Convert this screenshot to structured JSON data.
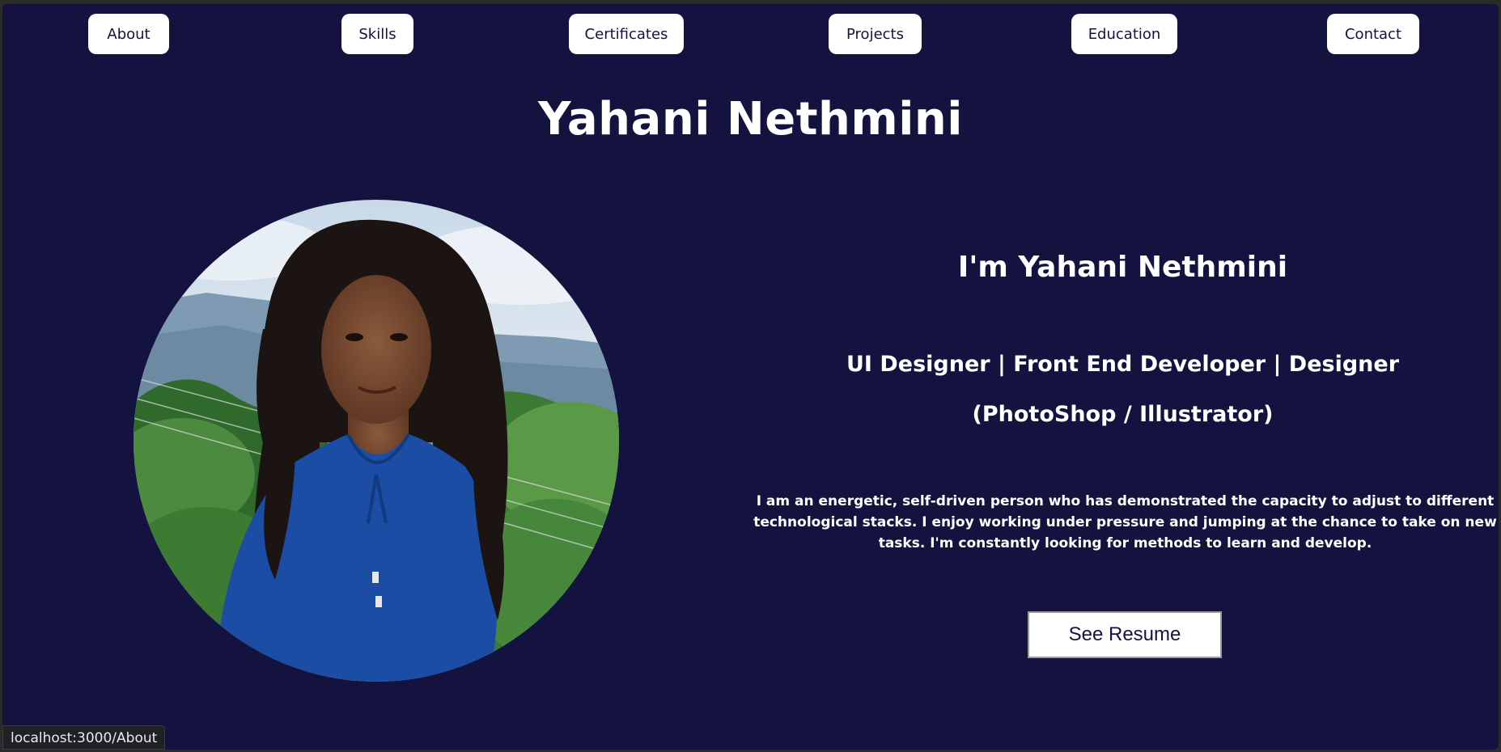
{
  "nav": {
    "items": [
      {
        "label": "About"
      },
      {
        "label": "Skills"
      },
      {
        "label": "Certificates"
      },
      {
        "label": "Projects"
      },
      {
        "label": "Education"
      },
      {
        "label": "Contact"
      }
    ]
  },
  "header": {
    "title": "Yahani Nethmini"
  },
  "profile": {
    "photo_icon": "profile-photo",
    "greeting": "I'm Yahani Nethmini",
    "role_line1": "UI Designer | Front End Developer | Designer",
    "role_line2": "(PhotoShop / Illustrator)",
    "bio": "I am an energetic, self-driven person who has demonstrated the capacity to adjust to different technological stacks. I enjoy working under pressure and jumping at the chance to take on new tasks. I'm constantly looking for methods to learn and develop.",
    "resume_label": "See Resume"
  },
  "status_bar": {
    "url": "localhost:3000/About"
  },
  "colors": {
    "background": "#141340",
    "button": "#ffffff",
    "text": "#ffffff"
  }
}
